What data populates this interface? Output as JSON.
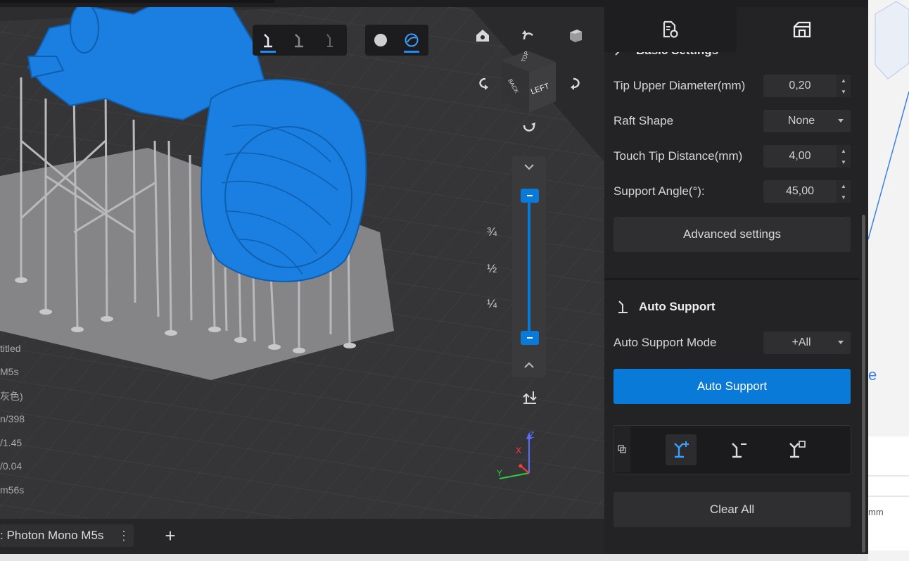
{
  "overlay_info": [
    "titled",
    "M5s",
    "灰色)",
    "n/398",
    "/1.45",
    "/0.04",
    "m56s"
  ],
  "viewport": {
    "slider_marks": [
      "¾",
      "½",
      "¼"
    ],
    "view_cube_faces": {
      "front": "LEFT",
      "side": "BACK",
      "top": "TOP"
    },
    "axis_labels": {
      "x": "X",
      "y": "Y",
      "z": "Z"
    },
    "toolbar_left": [
      "support-tree-icon",
      "support-line-icon",
      "support-thin-icon"
    ],
    "toolbar_right": [
      "solid-view-icon",
      "xray-view-icon"
    ]
  },
  "panel": {
    "tabs": [
      "file-settings-icon",
      "support-settings-icon"
    ],
    "basic_settings_title": "Basic Settings",
    "fields": [
      {
        "label": "Tip Upper Diameter(mm)",
        "value": "0,20"
      },
      {
        "label": "Raft Shape",
        "value": "None"
      },
      {
        "label": "Touch Tip Distance(mm)",
        "value": "4,00"
      },
      {
        "label": "Support Angle(°):",
        "value": "45,00"
      }
    ],
    "advanced_settings": "Advanced settings",
    "auto_support_title": "Auto Support",
    "auto_support_mode_label": "Auto Support Mode",
    "auto_support_mode_value": "+All",
    "auto_support_button": "Auto Support",
    "clear_all_button": "Clear All"
  },
  "bottom": {
    "machine_tab": ": Photon Mono M5s",
    "add_tab": "+"
  },
  "far_right": {
    "unit_text": "mm",
    "side_glyph": "e"
  },
  "colors": {
    "model": "#1a7fe0",
    "accent": "#0a7ad8",
    "panel_bg": "#232325"
  }
}
